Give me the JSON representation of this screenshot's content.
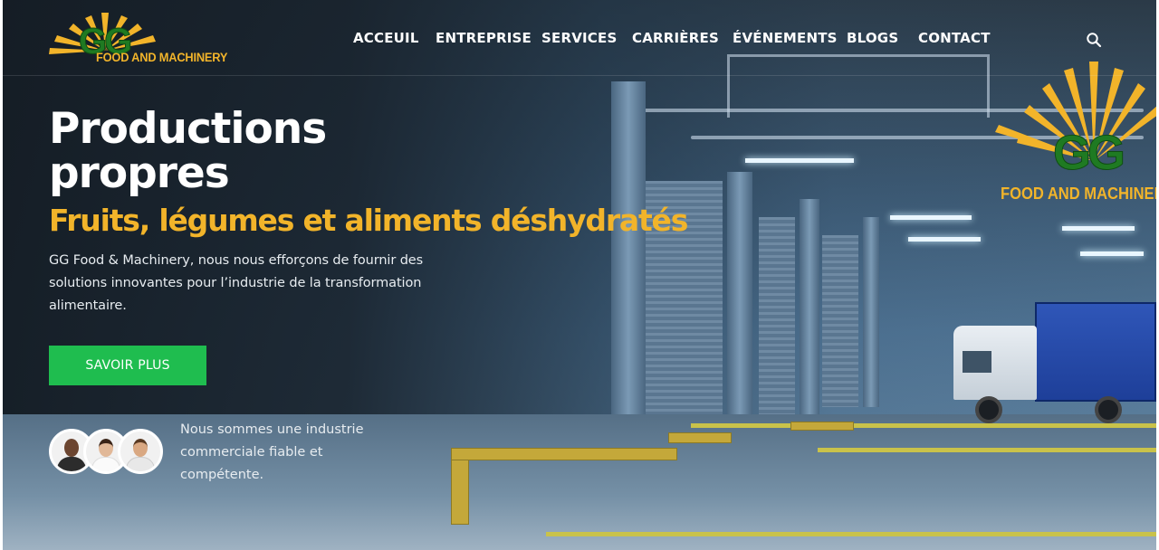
{
  "brand": {
    "logo_letters": "GG",
    "logo_text": "FOOD AND MACHINERY"
  },
  "nav": {
    "items": [
      {
        "label": "ACCEUIL"
      },
      {
        "label": "ENTREPRISE"
      },
      {
        "label": "SERVICES"
      },
      {
        "label": "CARRIÈRES"
      },
      {
        "label": "ÉVÉNEMENTS"
      },
      {
        "label": "BLOGS"
      },
      {
        "label": "CONTACT"
      }
    ],
    "search_icon": "search-icon"
  },
  "hero": {
    "title": "Productions propres",
    "subtitle": "Fruits, légumes et aliments déshydratés",
    "description": "GG Food & Machinery, nous nous efforçons de fournir des solutions innovantes pour l’industrie de la transformation alimentaire.",
    "cta_label": "SAVOIR PLUS",
    "trust_text": "Nous sommes une industrie commerciale fiable et compétente."
  },
  "colors": {
    "accent_yellow": "#f2b42a",
    "cta_green": "#1fbd4f",
    "logo_green": "#1f7a22"
  }
}
